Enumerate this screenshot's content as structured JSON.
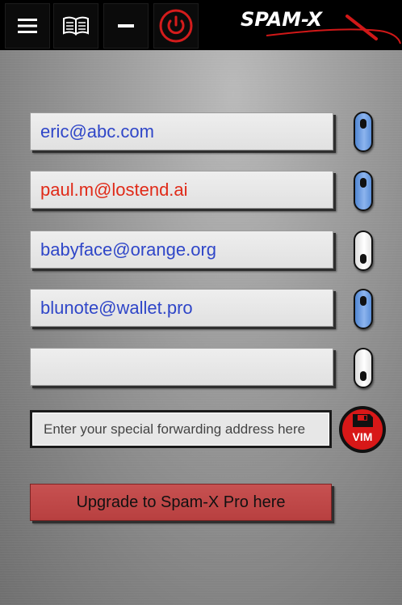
{
  "app": {
    "logo_text": "SPAM-X"
  },
  "toolbar": {
    "icons": [
      "menu-icon",
      "book-icon",
      "minimize-icon",
      "power-icon"
    ],
    "power_color": "#d41c1c"
  },
  "addresses": [
    {
      "value": "eric@abc.com",
      "text_color": "#2f46c8",
      "enabled": true
    },
    {
      "value": "paul.m@lostend.ai",
      "text_color": "#e02a18",
      "enabled": true
    },
    {
      "value": "babyface@orange.org",
      "text_color": "#2f46c8",
      "enabled": false
    },
    {
      "value": "blunote@wallet.pro",
      "text_color": "#2f46c8",
      "enabled": true
    },
    {
      "value": "",
      "text_color": "#2f46c8",
      "enabled": false
    }
  ],
  "forwarding": {
    "placeholder": "Enter your special forwarding address here",
    "save_button_label": "VIM"
  },
  "upgrade": {
    "label": "Upgrade to Spam-X Pro here",
    "color": "#c24a4a"
  },
  "colors": {
    "toggle_on": "#6a9be0",
    "toggle_off": "#f2f2f2",
    "save_button": "#d81818"
  }
}
